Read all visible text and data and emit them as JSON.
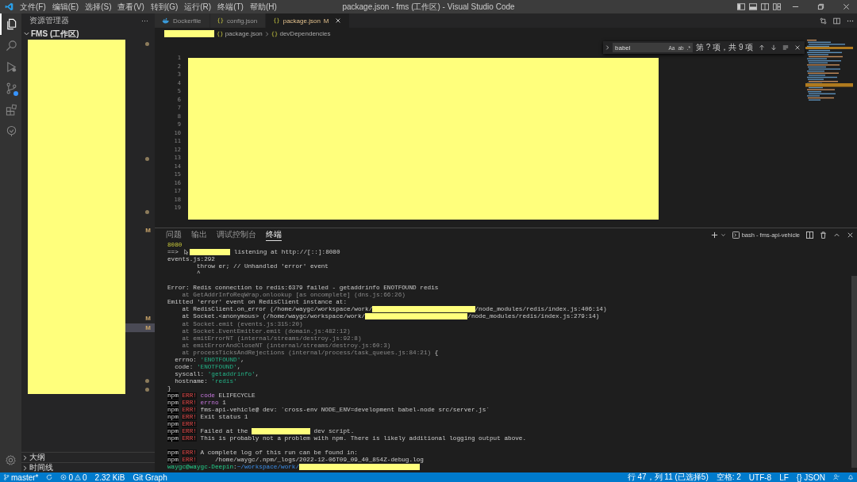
{
  "window": {
    "title": "package.json - fms (工作区) - Visual Studio Code"
  },
  "menu": [
    "文件(F)",
    "编辑(E)",
    "选择(S)",
    "查看(V)",
    "转到(G)",
    "运行(R)",
    "终端(T)",
    "帮助(H)"
  ],
  "activity_bar": [
    {
      "kind": "explorer",
      "selected": true
    },
    {
      "kind": "search",
      "selected": false
    },
    {
      "kind": "debug",
      "selected": false
    },
    {
      "kind": "scm",
      "selected": false,
      "badge": true
    },
    {
      "kind": "extensions",
      "selected": false
    },
    {
      "kind": "remote",
      "selected": false
    }
  ],
  "sidebar": {
    "title": "资源管理器",
    "more": "···",
    "workspace": "FMS (工作区)",
    "expanded": true,
    "rows": [
      {
        "selected": false,
        "modified_dot": true
      },
      {
        "selected": false,
        "modified_dot": true
      },
      {
        "selected": false,
        "modified_dot": true
      },
      {
        "selected": false,
        "git_status": "M"
      },
      {
        "selected": false,
        "git_status": "M"
      },
      {
        "selected": true,
        "git_status": "M"
      },
      {
        "selected": false,
        "modified_dot": true
      },
      {
        "selected": false,
        "modified_dot": true
      }
    ],
    "sections": [
      {
        "label": "大纲",
        "expanded": false
      },
      {
        "label": "时间线",
        "expanded": false
      }
    ]
  },
  "editor_tabs": [
    {
      "label": "Dockerfile",
      "kind": "docker",
      "selected": false
    },
    {
      "label": "config.json",
      "kind": "json",
      "symbol": "{}",
      "selected": false
    },
    {
      "label": "package.json",
      "kind": "json",
      "symbol": "{}",
      "selected": true,
      "modified": true,
      "status": "M"
    }
  ],
  "breadcrumb": [
    {
      "symbol": "{}",
      "text": "package.json"
    },
    {
      "symbol": "{}",
      "text": "devDependencies"
    }
  ],
  "find_widget": {
    "query": "babel",
    "options": [
      "Aa",
      "ab",
      ".*"
    ],
    "result": "第 ? 项，共 9 项"
  },
  "line_numbers": [
    "1",
    "2",
    "3",
    "4",
    "5",
    "6",
    "7",
    "8",
    "9",
    "10",
    "11",
    "12",
    "13",
    "14",
    "15",
    "16",
    "17",
    "18",
    "19"
  ],
  "panel": {
    "tabs": [
      {
        "label": "问题",
        "selected": false
      },
      {
        "label": "输出",
        "selected": false
      },
      {
        "label": "调试控制台",
        "selected": false
      },
      {
        "label": "终端",
        "selected": true
      }
    ],
    "terminal_name": "bash - fms-api-vehicle",
    "lines": [
      {
        "kind": "output",
        "segments": [
          {
            "kind": "number",
            "text": "8080"
          }
        ]
      },
      {
        "kind": "output",
        "segments": [
          {
            "kind": "text",
            "text": "==> "
          },
          {
            "kind": "pointer"
          },
          {
            "kind": "redaction-short"
          },
          {
            "kind": "text",
            "text": " listening at http://[::]:8080"
          }
        ]
      },
      {
        "kind": "output",
        "segments": [
          {
            "kind": "text",
            "text": "events.js:292"
          }
        ]
      },
      {
        "kind": "output",
        "segments": [
          {
            "kind": "text",
            "text": "        throw er; // Unhandled 'error' event"
          }
        ]
      },
      {
        "kind": "output",
        "segments": [
          {
            "kind": "text",
            "text": "        ^"
          }
        ]
      },
      {
        "kind": "blank"
      },
      {
        "kind": "output",
        "segments": [
          {
            "kind": "text",
            "text": "Error: Redis connection to redis:6379 failed - getaddrinfo ENOTFOUND redis"
          }
        ]
      },
      {
        "kind": "output",
        "segments": [
          {
            "kind": "dim",
            "text": "    at GetAddrInfoReqWrap.onlookup [as oncomplete] (dns.js:66:26)"
          }
        ]
      },
      {
        "kind": "output",
        "segments": [
          {
            "kind": "text",
            "text": "Emitted 'error' event on RedisClient instance at:"
          }
        ]
      },
      {
        "kind": "output",
        "segments": [
          {
            "kind": "text",
            "text": "    at RedisClient.on_error (/home/waygc/workspace/work/"
          },
          {
            "kind": "redaction-long"
          },
          {
            "kind": "text",
            "text": "/node_modules/redis/index.js:406:14)"
          }
        ]
      },
      {
        "kind": "output",
        "segments": [
          {
            "kind": "text",
            "text": "    at Socket.<anonymous> (/home/waygc/workspace/work/"
          },
          {
            "kind": "redaction-long"
          },
          {
            "kind": "text",
            "text": "/node_modules/redis/index.js:279:14)"
          }
        ]
      },
      {
        "kind": "output",
        "segments": [
          {
            "kind": "dim",
            "text": "    at Socket.emit (events.js:315:20)"
          }
        ]
      },
      {
        "kind": "output",
        "segments": [
          {
            "kind": "dim",
            "text": "    at Socket.EventEmitter.emit (domain.js:482:12)"
          }
        ]
      },
      {
        "kind": "output",
        "segments": [
          {
            "kind": "dim",
            "text": "    at emitErrorNT (internal/streams/destroy.js:92:8)"
          }
        ]
      },
      {
        "kind": "output",
        "segments": [
          {
            "kind": "dim",
            "text": "    at emitErrorAndCloseNT (internal/streams/destroy.js:60:3)"
          }
        ]
      },
      {
        "kind": "output",
        "segments": [
          {
            "kind": "dim",
            "text": "    at processTicksAndRejections (internal/process/task_queues.js:84:21)"
          },
          {
            "kind": "text",
            "text": " {"
          }
        ]
      },
      {
        "kind": "output",
        "segments": [
          {
            "kind": "text",
            "text": "  errno: "
          },
          {
            "kind": "string",
            "text": "'ENOTFOUND'"
          },
          {
            "kind": "text",
            "text": ","
          }
        ]
      },
      {
        "kind": "output",
        "segments": [
          {
            "kind": "text",
            "text": "  code: "
          },
          {
            "kind": "string",
            "text": "'ENOTFOUND'"
          },
          {
            "kind": "text",
            "text": ","
          }
        ]
      },
      {
        "kind": "output",
        "segments": [
          {
            "kind": "text",
            "text": "  syscall: "
          },
          {
            "kind": "string",
            "text": "'getaddrinfo'"
          },
          {
            "kind": "text",
            "text": ","
          }
        ]
      },
      {
        "kind": "output",
        "segments": [
          {
            "kind": "text",
            "text": "  hostname: "
          },
          {
            "kind": "string",
            "text": "'redis'"
          }
        ]
      },
      {
        "kind": "output",
        "segments": [
          {
            "kind": "text",
            "text": "}"
          }
        ]
      },
      {
        "kind": "output",
        "segments": [
          {
            "kind": "npm",
            "text": "npm"
          },
          {
            "kind": "err",
            "text": "ERR!"
          },
          {
            "kind": "keyword",
            "text": "code"
          },
          {
            "kind": "text",
            "text": " ELIFECYCLE"
          }
        ]
      },
      {
        "kind": "output",
        "segments": [
          {
            "kind": "npm",
            "text": "npm"
          },
          {
            "kind": "err",
            "text": "ERR!"
          },
          {
            "kind": "keyword",
            "text": "errno"
          },
          {
            "kind": "text",
            "text": " 1"
          }
        ]
      },
      {
        "kind": "output",
        "segments": [
          {
            "kind": "npm",
            "text": "npm"
          },
          {
            "kind": "err",
            "text": "ERR!"
          },
          {
            "kind": "text",
            "text": "fms-api-vehicle@ dev: `cross-env NODE_ENV=development babel-node src/server.js`"
          }
        ]
      },
      {
        "kind": "output",
        "segments": [
          {
            "kind": "npm",
            "text": "npm"
          },
          {
            "kind": "err",
            "text": "ERR!"
          },
          {
            "kind": "text",
            "text": "Exit status 1"
          }
        ]
      },
      {
        "kind": "output",
        "segments": [
          {
            "kind": "npm",
            "text": "npm"
          },
          {
            "kind": "err",
            "text": "ERR!"
          }
        ]
      },
      {
        "kind": "output",
        "segments": [
          {
            "kind": "npm",
            "text": "npm"
          },
          {
            "kind": "err",
            "text": "ERR!"
          },
          {
            "kind": "text",
            "text": "Failed at the "
          },
          {
            "kind": "redaction-medium"
          },
          {
            "kind": "text",
            "text": " dev script."
          }
        ]
      },
      {
        "kind": "output",
        "segments": [
          {
            "kind": "npm",
            "text": "npm"
          },
          {
            "kind": "err",
            "text": "ERR!"
          },
          {
            "kind": "text",
            "text": "This is probably not a problem with npm. There is likely additional logging output above."
          }
        ]
      },
      {
        "kind": "blank"
      },
      {
        "kind": "output",
        "segments": [
          {
            "kind": "npm",
            "text": "npm"
          },
          {
            "kind": "err",
            "text": "ERR!"
          },
          {
            "kind": "text",
            "text": "A complete log of this run can be found in:"
          }
        ]
      },
      {
        "kind": "output",
        "segments": [
          {
            "kind": "npm",
            "text": "npm"
          },
          {
            "kind": "err",
            "text": "ERR!"
          },
          {
            "kind": "text",
            "text": "    /home/waygc/.npm/_logs/2022-12-06T09_09_40_854Z-debug.log"
          }
        ]
      },
      {
        "kind": "output",
        "segments": [
          {
            "kind": "prompt",
            "text": "waygc@waygc-Deepin"
          },
          {
            "kind": "text",
            "text": ":"
          },
          {
            "kind": "path",
            "text": "~/workspace/work/"
          },
          {
            "kind": "redaction-longer"
          }
        ]
      }
    ]
  },
  "status_bar": {
    "left": [
      {
        "kind": "branch",
        "text": "master*"
      },
      {
        "kind": "sync"
      },
      {
        "kind": "problems",
        "errors": "0",
        "warnings": "0"
      },
      {
        "kind": "text",
        "text": "2.32 KiB"
      },
      {
        "kind": "text",
        "text": "Git Graph"
      }
    ],
    "right": [
      {
        "kind": "text",
        "text": "行 47，列 11 (已选择5)"
      },
      {
        "kind": "text",
        "text": "空格: 2"
      },
      {
        "kind": "text",
        "text": "UTF-8"
      },
      {
        "kind": "text",
        "text": "LF"
      },
      {
        "kind": "language",
        "symbol": "{}",
        "text": "JSON"
      },
      {
        "kind": "feedback"
      },
      {
        "kind": "bell"
      }
    ]
  }
}
